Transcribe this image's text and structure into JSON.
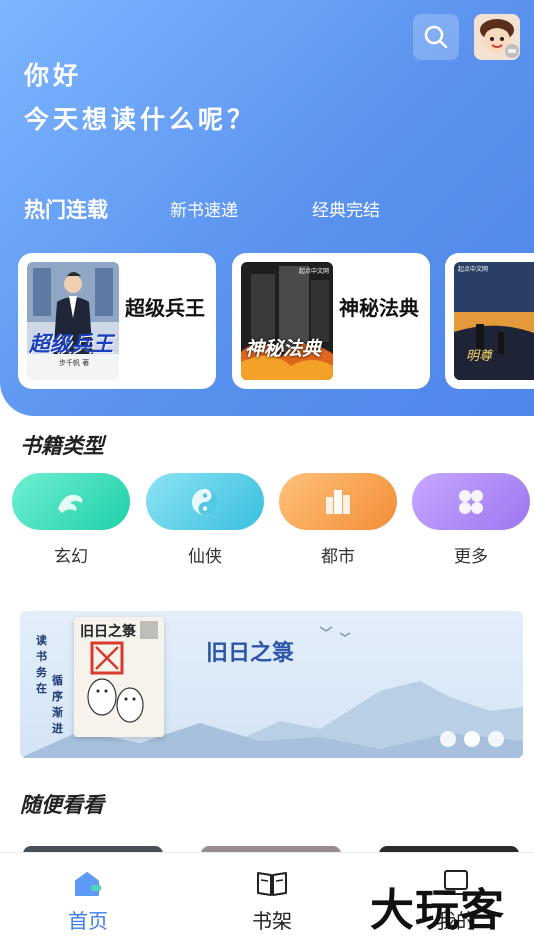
{
  "header": {
    "greeting_line1": "你好",
    "greeting_line2": "今天想读什么呢？",
    "tabs": [
      {
        "label": "热门连载",
        "active": true
      },
      {
        "label": "新书速递",
        "active": false
      },
      {
        "label": "经典完结",
        "active": false
      }
    ]
  },
  "featured_books": [
    {
      "title": "超级兵王",
      "cover_text": "超级兵王",
      "cover_author": "步千帆 著"
    },
    {
      "title": "神秘法典",
      "cover_text": "神秘法典",
      "cover_publisher": "起点中文网"
    },
    {
      "title": "",
      "cover_text": "",
      "cover_publisher": "起点中文网"
    }
  ],
  "categories_section": {
    "title": "书籍类型",
    "items": [
      {
        "label": "玄幻",
        "icon": "dragon-icon",
        "color": "#2fd6b4"
      },
      {
        "label": "仙侠",
        "icon": "yin-yang-icon",
        "color": "#4fc7e2"
      },
      {
        "label": "都市",
        "icon": "city-icon",
        "color": "#f49a45"
      },
      {
        "label": "更多",
        "icon": "more-grid-icon",
        "color": "#a880f2"
      }
    ]
  },
  "banner": {
    "title": "旧日之箓",
    "cover_title": "旧日之箓",
    "side_text_left": "读书务在",
    "side_text_right": "循序渐进",
    "slides": 3,
    "active_slide": 2
  },
  "random_section": {
    "title": "随便看看"
  },
  "bottom_nav": {
    "items": [
      {
        "label": "首页",
        "icon": "home-icon",
        "active": true
      },
      {
        "label": "书架",
        "icon": "bookshelf-icon",
        "active": false
      },
      {
        "label": "我的",
        "icon": "profile-icon",
        "active": false
      }
    ]
  },
  "watermark": "大玩客",
  "colors": {
    "accent": "#3e7ee9",
    "hero_start": "#7cb6ff",
    "hero_end": "#4f86ea"
  }
}
